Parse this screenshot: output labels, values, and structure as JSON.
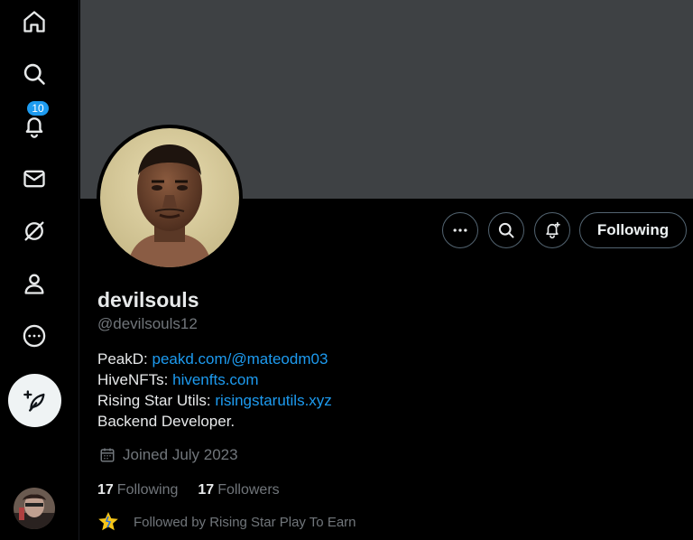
{
  "nav": {
    "items": [
      {
        "name": "home-icon"
      },
      {
        "name": "search-icon"
      },
      {
        "name": "notifications-icon",
        "badge": "10"
      },
      {
        "name": "messages-icon"
      },
      {
        "name": "grok-icon"
      },
      {
        "name": "profile-icon"
      },
      {
        "name": "more-icon"
      }
    ],
    "compose_icon": "compose-feather-icon"
  },
  "profile": {
    "display_name": "devilsouls",
    "handle": "@devilsouls12",
    "bio": {
      "line1_label": "PeakD: ",
      "line1_link": "peakd.com/@mateodm03",
      "line2_label": "HiveNFTs: ",
      "line2_link": "hivenfts.com",
      "line3_label": "Rising Star Utils: ",
      "line3_link": "risingstarutils.xyz",
      "line4": "Backend Developer."
    },
    "joined": "Joined July 2023",
    "following_count": "17",
    "following_label": "Following",
    "followers_count": "17",
    "followers_label": "Followers",
    "followed_by": "Followed by Rising Star Play To Earn"
  },
  "actions": {
    "following_button": "Following"
  },
  "colors": {
    "accent": "#1d9bf0",
    "banner": "#3e4144",
    "muted_text": "#71767b"
  }
}
